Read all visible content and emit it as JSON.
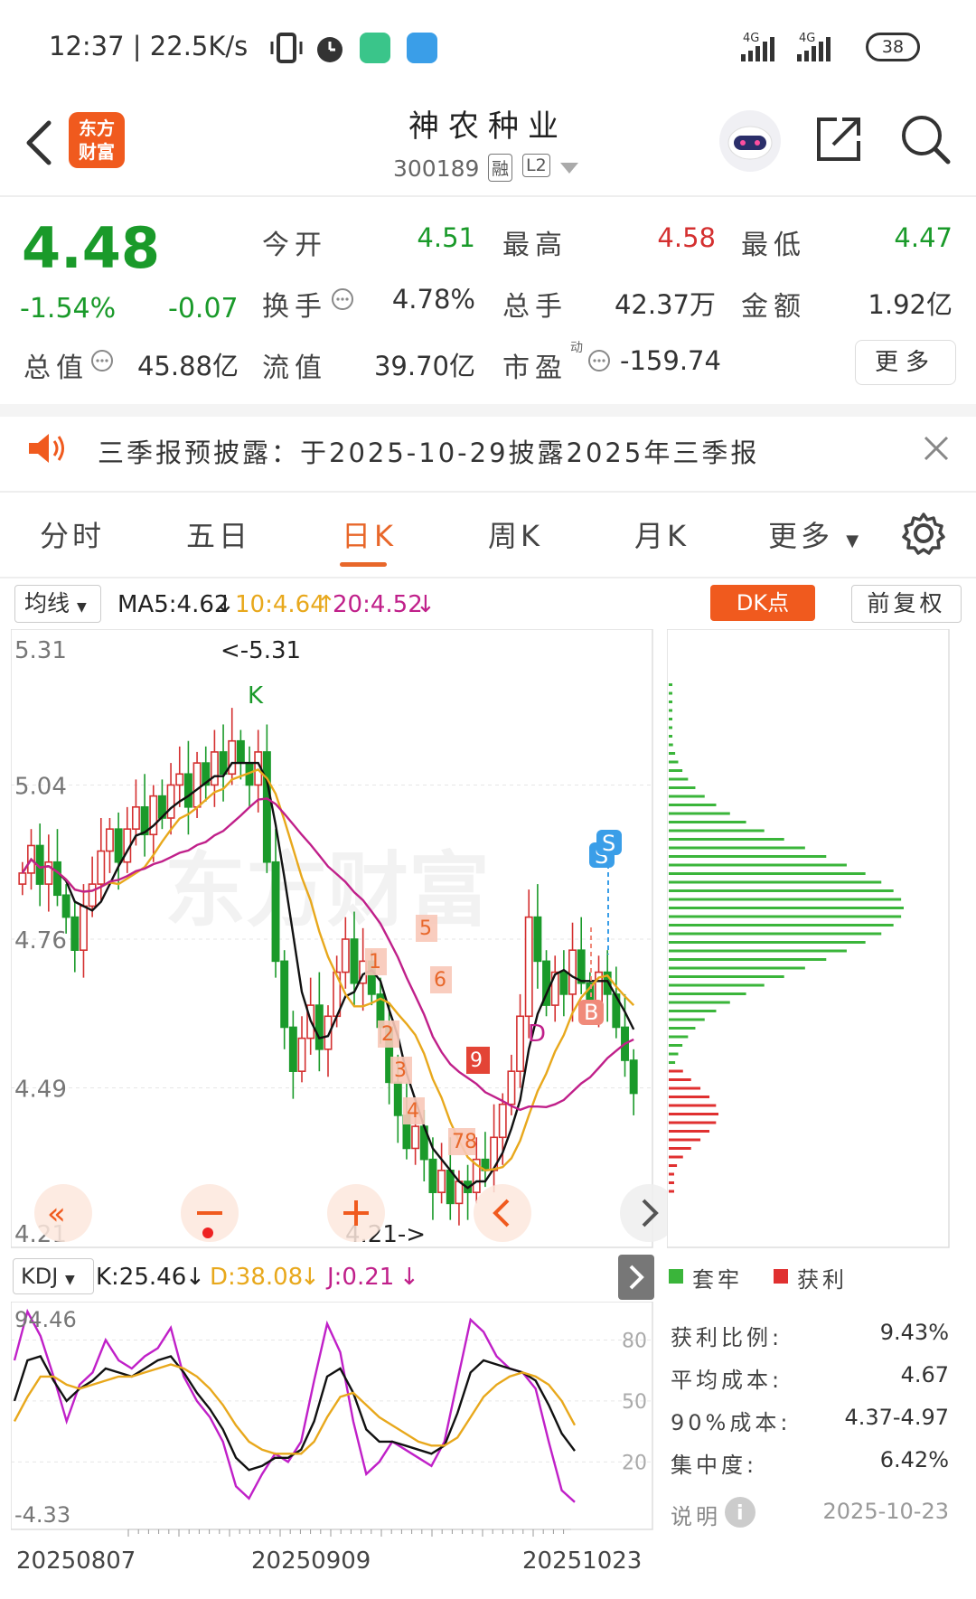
{
  "status_bar": {
    "time": "12:37",
    "speed": "22.5K/s",
    "battery": "38",
    "net1": "4G",
    "net2": "4G",
    "icons": [
      "vibrate-icon",
      "alarm-icon",
      "shield-app-icon",
      "cloud-app-icon"
    ]
  },
  "header": {
    "logo_line1": "东方",
    "logo_line2": "财富",
    "stock_name": "神农种业",
    "stock_code": "300189",
    "tag_rong": "融",
    "tag_l2": "L2"
  },
  "quote": {
    "price": "4.48",
    "change_pct": "-1.54%",
    "change_amt": "-0.07",
    "open_label": "今开",
    "open": "4.51",
    "high_label": "最高",
    "high": "4.58",
    "low_label": "最低",
    "low": "4.47",
    "turnover_label": "换手",
    "turnover": "4.78%",
    "volume_label": "总手",
    "volume": "42.37万",
    "amount_label": "金额",
    "amount": "1.92亿",
    "mktcap_label": "总值",
    "mktcap": "45.88亿",
    "float_label": "流值",
    "float_cap": "39.70亿",
    "pe_label": "市盈",
    "pe_sup": "动",
    "pe": "-159.74",
    "more": "更多"
  },
  "notice": {
    "text": "三季报预披露：于2025-10-29披露2025年三季报"
  },
  "tabs": [
    {
      "label": "分时"
    },
    {
      "label": "五日"
    },
    {
      "label": "日K"
    },
    {
      "label": "周K"
    },
    {
      "label": "月K"
    },
    {
      "label": "更多"
    }
  ],
  "chart_toolbar": {
    "ma_btn": "均线",
    "ma5": "MA5:4.62",
    "ma10": "10:4.64",
    "ma20": "20:4.52",
    "dk_btn": "DK点",
    "fq_btn": "前复权"
  },
  "main_chart": {
    "y_ticks": [
      "5.31",
      "5.04",
      "4.76",
      "4.49",
      "4.21"
    ],
    "high_marker": "<-5.31",
    "low_marker": "4.21->",
    "k_mark": "K",
    "d_mark": "D",
    "s_mark": "S",
    "b_mark": "B",
    "watermark": "东方财富",
    "nine_labels": [
      "1",
      "2",
      "3",
      "4",
      "5",
      "6",
      "78",
      "9"
    ]
  },
  "chips": {
    "legend_trapped": "套牢",
    "legend_profit": "获利",
    "rows": [
      {
        "label": "获利比例:",
        "value": "9.43%"
      },
      {
        "label": "平均成本:",
        "value": "4.67"
      },
      {
        "label": "90%成本:",
        "value": "4.37-4.97"
      },
      {
        "label": "集中度:",
        "value": "6.42%"
      },
      {
        "label": "说明",
        "value": "2025-10-23"
      }
    ]
  },
  "kdj": {
    "btn": "KDJ",
    "k": "K:25.46",
    "d": "D:38.08",
    "j": "J:0.21",
    "y_top": "94.46",
    "y_bottom": "-4.33",
    "r80": "80",
    "r50": "50",
    "r20": "20"
  },
  "x_dates": [
    "20250807",
    "20250909",
    "20251023"
  ],
  "colors": {
    "up": "#d43030",
    "down": "#1a9a2a",
    "accent": "#e8672a",
    "ma5": "#111111",
    "ma10": "#e8a81c",
    "ma20": "#c0208a"
  },
  "chart_data": [
    {
      "type": "candlestick",
      "ylim": [
        4.21,
        5.31
      ],
      "y_ticks": [
        5.31,
        5.04,
        4.76,
        4.49,
        4.21
      ],
      "x_ticks": [
        "20250807",
        "20250909",
        "20251023"
      ],
      "series": [
        {
          "name": "MA5",
          "last": 4.62
        },
        {
          "name": "10",
          "last": 4.64
        },
        {
          "name": "20",
          "last": 4.52
        }
      ]
    },
    {
      "type": "line",
      "ylim": [
        -4.33,
        94.46
      ],
      "series": [
        {
          "name": "K",
          "last": 25.46
        },
        {
          "name": "D",
          "last": 38.08
        },
        {
          "name": "J",
          "last": 0.21
        }
      ]
    }
  ]
}
